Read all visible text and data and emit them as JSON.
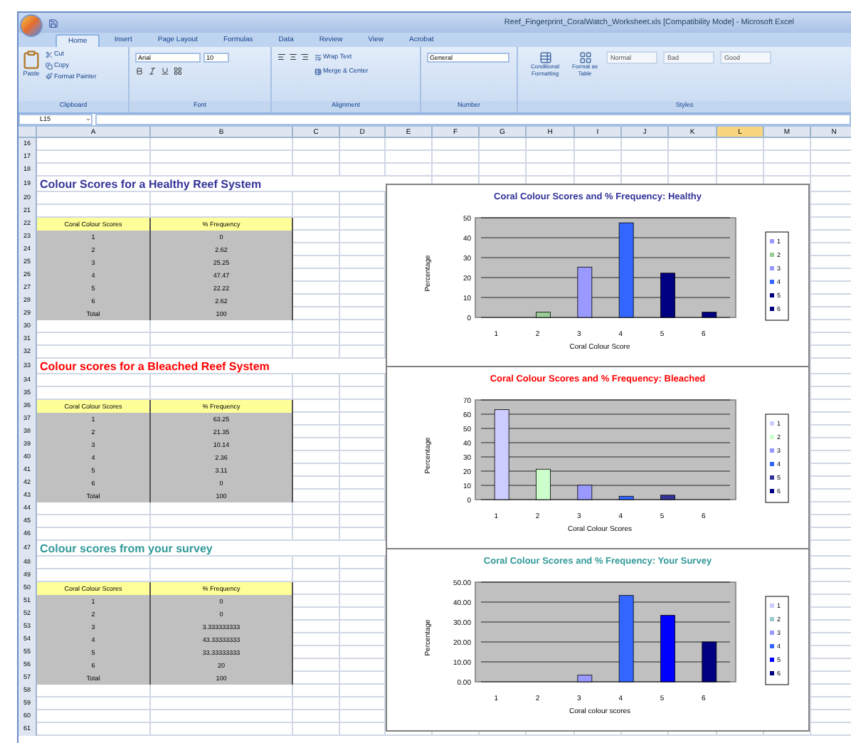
{
  "window": {
    "title": "Reef_Fingerprint_CoralWatch_Worksheet.xls [Compatibility Mode] - Microsoft Excel"
  },
  "tabs": [
    {
      "label": "Home",
      "selected": true
    },
    {
      "label": "Insert",
      "selected": false
    },
    {
      "label": "Page Layout",
      "selected": false
    },
    {
      "label": "Formulas",
      "selected": false
    },
    {
      "label": "Data",
      "selected": false
    },
    {
      "label": "Review",
      "selected": false
    },
    {
      "label": "View",
      "selected": false
    },
    {
      "label": "Acrobat",
      "selected": false
    }
  ],
  "ribbon": {
    "clipboard": {
      "paste": "Paste",
      "cut": "Cut",
      "copy": "Copy",
      "format_painter": "Format Painter",
      "group": "Clipboard"
    },
    "font": {
      "name": "Arial",
      "size": "10",
      "group": "Font"
    },
    "alignment": {
      "wrap": "Wrap Text",
      "merge": "Merge & Center",
      "group": "Alignment"
    },
    "number": {
      "format": "General",
      "group": "Number"
    },
    "styles": {
      "conditional": "Conditional Formatting",
      "table": "Format as Table",
      "cells": [
        "Normal",
        "Bad",
        "Good"
      ],
      "group": "Styles"
    }
  },
  "formula_bar": {
    "name_box": "L15"
  },
  "sheet": {
    "columns": [
      {
        "label": "A",
        "selected": false
      },
      {
        "label": "B",
        "selected": false
      },
      {
        "label": "C",
        "selected": false
      },
      {
        "label": "D",
        "selected": false
      },
      {
        "label": "E",
        "selected": false
      },
      {
        "label": "F",
        "selected": false
      },
      {
        "label": "G",
        "selected": false
      },
      {
        "label": "H",
        "selected": false
      },
      {
        "label": "I",
        "selected": false
      },
      {
        "label": "J",
        "selected": false
      },
      {
        "label": "K",
        "selected": false
      },
      {
        "label": "L",
        "selected": true
      },
      {
        "label": "M",
        "selected": false
      },
      {
        "label": "N",
        "selected": false
      }
    ],
    "row_numbers": [
      "16",
      "17",
      "18",
      "19",
      "20",
      "21",
      "22",
      "23",
      "24",
      "25",
      "26",
      "27",
      "28",
      "29",
      "30",
      "31",
      "32",
      "33",
      "34",
      "35",
      "36",
      "37",
      "38",
      "39",
      "40",
      "41",
      "42",
      "43",
      "44",
      "45",
      "46",
      "47",
      "48",
      "49",
      "50",
      "51",
      "52",
      "53",
      "54",
      "55",
      "56",
      "57",
      "58",
      "59",
      "60",
      "61"
    ],
    "sections": [
      {
        "title": "Colour Scores for a Healthy Reef System",
        "color": "#333399",
        "header": [
          "Coral Colour Scores",
          "% Frequency"
        ],
        "rows": [
          [
            "1",
            "0"
          ],
          [
            "2",
            "2.62"
          ],
          [
            "3",
            "25.25"
          ],
          [
            "4",
            "47.47"
          ],
          [
            "5",
            "22.22"
          ],
          [
            "6",
            "2.62"
          ],
          [
            "Total",
            "100"
          ]
        ]
      },
      {
        "title": "Colour scores for a Bleached Reef System",
        "color": "#ff0000",
        "header": [
          "Coral Colour Scores",
          "% Frequency"
        ],
        "rows": [
          [
            "1",
            "63.25"
          ],
          [
            "2",
            "21.35"
          ],
          [
            "3",
            "10.14"
          ],
          [
            "4",
            "2.36"
          ],
          [
            "5",
            "3.11"
          ],
          [
            "6",
            "0"
          ],
          [
            "Total",
            "100"
          ]
        ]
      },
      {
        "title": "Colour scores from your survey",
        "color": "#339999",
        "header": [
          "Coral Colour Scores",
          "% Frequency"
        ],
        "rows": [
          [
            "1",
            "0"
          ],
          [
            "2",
            "0"
          ],
          [
            "3",
            "3.333333333"
          ],
          [
            "4",
            "43.33333333"
          ],
          [
            "5",
            "33.33333333"
          ],
          [
            "6",
            "20"
          ],
          [
            "Total",
            "100"
          ]
        ]
      }
    ]
  },
  "charts": [
    {
      "color": "#333399",
      "legend": [
        {
          "label": "1",
          "color": "#9999ff"
        },
        {
          "label": "2",
          "color": "#99cc99"
        },
        {
          "label": "3",
          "color": "#9999ff"
        },
        {
          "label": "4",
          "color": "#3366ff"
        },
        {
          "label": "5",
          "color": "#000080"
        },
        {
          "label": "6",
          "color": "#000080"
        }
      ],
      "chart_data": {
        "type": "bar",
        "title": "Coral Colour Scores and % Frequency: Healthy",
        "xlabel": "Coral Colour Score",
        "ylabel": "Percentage",
        "categories": [
          "1",
          "2",
          "3",
          "4",
          "5",
          "6"
        ],
        "grid": true,
        "series": [
          {
            "values": [
              0,
              2.62,
              25.25,
              47.47,
              22.22,
              2.62
            ]
          }
        ],
        "ylim": [
          0,
          50
        ],
        "yticks": [
          0,
          10,
          20,
          30,
          40,
          50
        ]
      }
    },
    {
      "color": "#ff0000",
      "legend": [
        {
          "label": "1",
          "color": "#ccccff"
        },
        {
          "label": "2",
          "color": "#ccffcc"
        },
        {
          "label": "3",
          "color": "#9999ff"
        },
        {
          "label": "4",
          "color": "#3366ff"
        },
        {
          "label": "5",
          "color": "#333399"
        },
        {
          "label": "6",
          "color": "#000080"
        }
      ],
      "chart_data": {
        "type": "bar",
        "title": "Coral Colour Scores and % Frequency: Bleached",
        "xlabel": "Coral Colour Scores",
        "ylabel": "Percentage",
        "categories": [
          "1",
          "2",
          "3",
          "4",
          "5",
          "6"
        ],
        "grid": true,
        "series": [
          {
            "values": [
              63.25,
              21.35,
              10.14,
              2.36,
              3.11,
              0
            ]
          }
        ],
        "ylim": [
          0,
          70
        ],
        "yticks": [
          0,
          10,
          20,
          30,
          40,
          50,
          60,
          70
        ]
      }
    },
    {
      "color": "#339999",
      "legend": [
        {
          "label": "1",
          "color": "#ccccff"
        },
        {
          "label": "2",
          "color": "#99cccc"
        },
        {
          "label": "3",
          "color": "#9999ff"
        },
        {
          "label": "4",
          "color": "#3366ff"
        },
        {
          "label": "5",
          "color": "#0000ff"
        },
        {
          "label": "6",
          "color": "#000080"
        }
      ],
      "chart_data": {
        "type": "bar",
        "title": "Coral Colour Scores and % Frequency: Your Survey",
        "xlabel": "Coral colour scores",
        "ylabel": "Percentage",
        "categories": [
          "1",
          "2",
          "3",
          "4",
          "5",
          "6"
        ],
        "grid": true,
        "series": [
          {
            "values": [
              0,
              0,
              3.333333333,
              43.33333333,
              33.33333333,
              20
            ]
          }
        ],
        "ylim": [
          0,
          50
        ],
        "yticks": [
          {
            "value": 0,
            "label": "0.00"
          },
          {
            "value": 10,
            "label": "10.00"
          },
          {
            "value": 20,
            "label": "20.00"
          },
          {
            "value": 30,
            "label": "30.00"
          },
          {
            "value": 40,
            "label": "40.00"
          },
          {
            "value": 50,
            "label": "50.00"
          }
        ]
      }
    }
  ]
}
